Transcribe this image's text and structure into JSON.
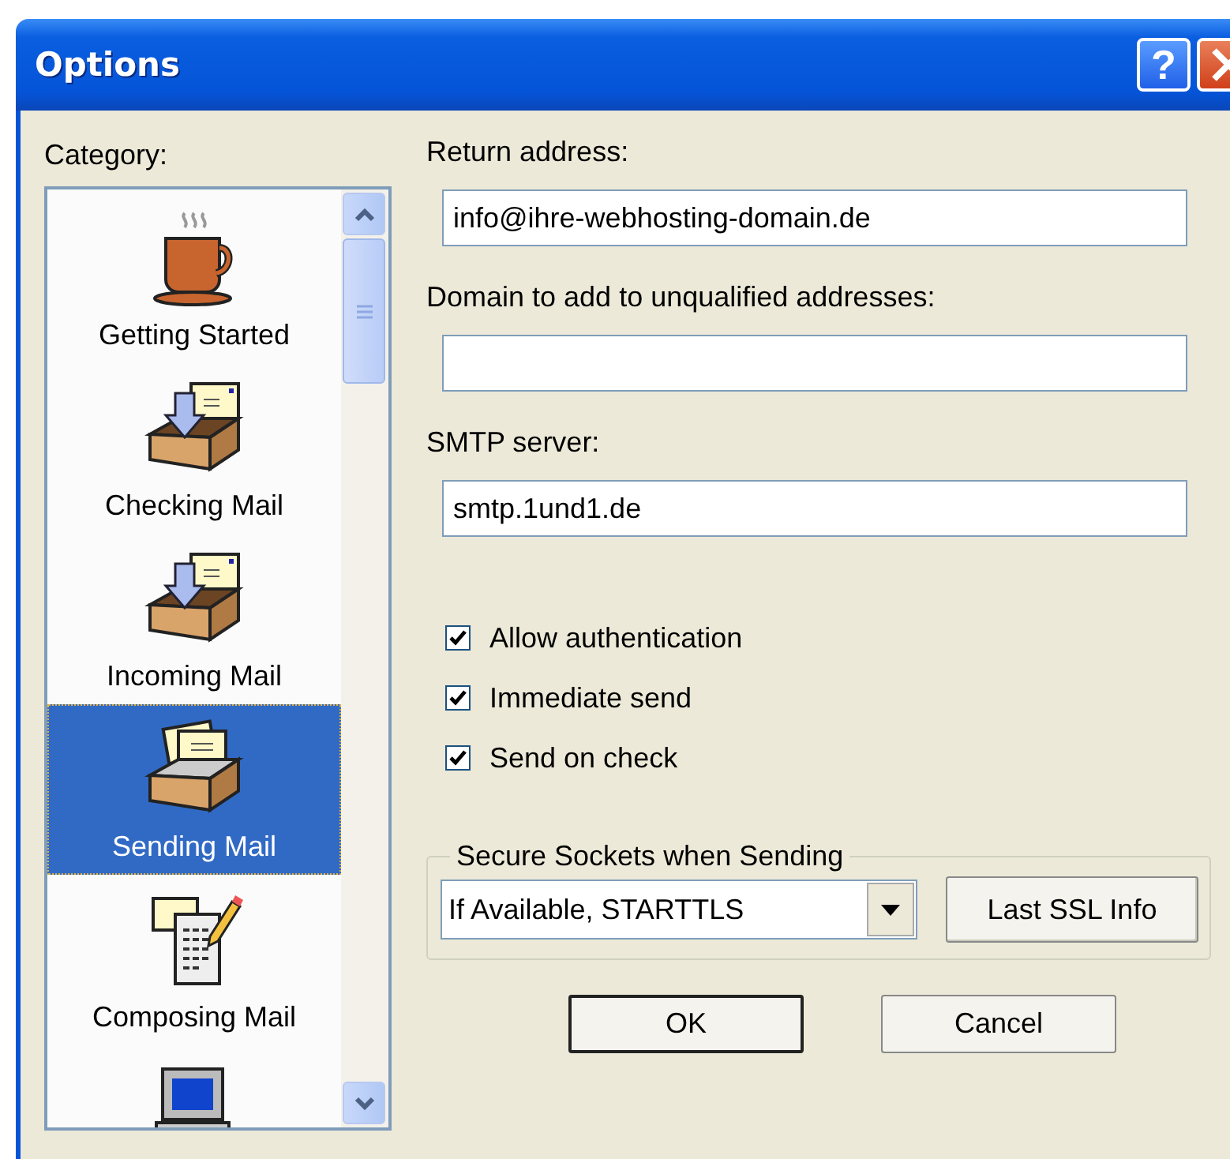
{
  "window": {
    "title": "Options",
    "help_button": "?"
  },
  "category": {
    "label": "Category:",
    "items": [
      {
        "kind": "coffee",
        "label": "Getting Started",
        "selected": false
      },
      {
        "kind": "inbox",
        "label": "Checking Mail",
        "selected": false
      },
      {
        "kind": "inbox",
        "label": "Incoming Mail",
        "selected": false
      },
      {
        "kind": "outbox",
        "label": "Sending Mail",
        "selected": true
      },
      {
        "kind": "compose",
        "label": "Composing Mail",
        "selected": false
      },
      {
        "kind": "computer",
        "selected": false
      }
    ]
  },
  "fields": [
    {
      "label": "Return address:",
      "value": "info@ihre-webhosting-domain.de"
    },
    {
      "label": "Domain to add to unqualified addresses:"
    },
    {
      "label": "SMTP server:",
      "value": "smtp.1und1.de"
    }
  ],
  "options": [
    {
      "label": "Allow authentication",
      "checked": true
    },
    {
      "label": "Immediate send",
      "checked": true
    },
    {
      "label": "Send on check",
      "checked": true
    }
  ],
  "ssl_group": {
    "title": "Secure Sockets when Sending",
    "dropdown": {
      "value": "If Available, STARTTLS"
    },
    "button": "Last SSL Info"
  },
  "buttons": [
    {
      "label": "OK",
      "default": true
    },
    {
      "label": "Cancel",
      "default": false
    }
  ]
}
